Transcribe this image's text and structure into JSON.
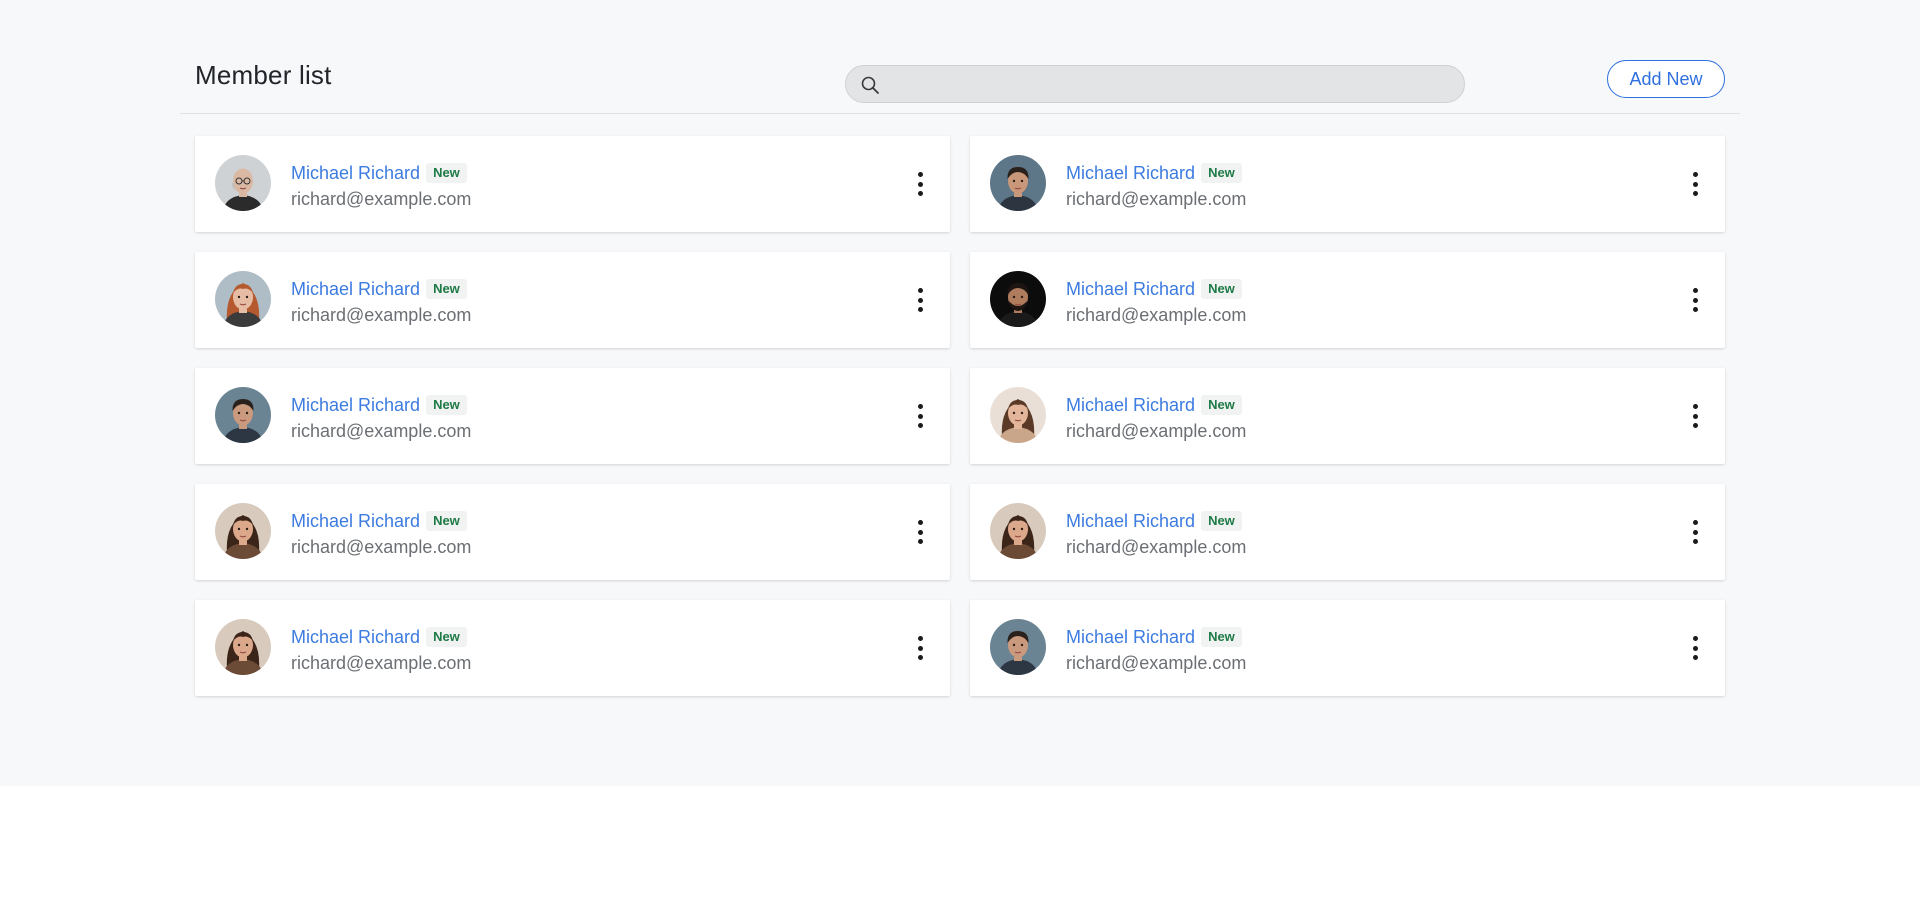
{
  "header": {
    "title": "Member list",
    "search_placeholder": "",
    "search_value": "",
    "add_button_label": "Add New"
  },
  "colors": {
    "accent": "#2f6fdf",
    "name_link": "#3c7be0",
    "badge_text": "#1e7a46",
    "page_bg": "#f7f8fa"
  },
  "members": [
    {
      "name": "Michael Richard",
      "badge": "New",
      "email": "richard@example.com",
      "avatar": "bald-man-glasses",
      "skin": "#d9b9a3",
      "hair": "#bfbfbf",
      "bg": "#cfd2d4",
      "shirt": "#2b2b2b"
    },
    {
      "name": "Michael Richard",
      "badge": "New",
      "email": "richard@example.com",
      "avatar": "young-man-dark-hair",
      "skin": "#c9987b",
      "hair": "#2a211c",
      "bg": "#5d7688",
      "shirt": "#2c3540"
    },
    {
      "name": "Michael Richard",
      "badge": "New",
      "email": "richard@example.com",
      "avatar": "red-hair-woman",
      "skin": "#e6bda4",
      "hair": "#b5592f",
      "bg": "#aebdc6",
      "shirt": "#3b3b3b"
    },
    {
      "name": "Michael Richard",
      "badge": "New",
      "email": "richard@example.com",
      "avatar": "bearded-man",
      "skin": "#b07c5e",
      "hair": "#1d1511",
      "bg": "#0c0c0c",
      "shirt": "#1a1a1a"
    },
    {
      "name": "Michael Richard",
      "badge": "New",
      "email": "richard@example.com",
      "avatar": "man-suit",
      "skin": "#c99a7e",
      "hair": "#2a211c",
      "bg": "#6b8494",
      "shirt": "#2d3744"
    },
    {
      "name": "Michael Richard",
      "badge": "New",
      "email": "richard@example.com",
      "avatar": "long-hair-woman",
      "skin": "#e3b59a",
      "hair": "#5a3a26",
      "bg": "#e9dfd6",
      "shirt": "#c9a58a"
    },
    {
      "name": "Michael Richard",
      "badge": "New",
      "email": "richard@example.com",
      "avatar": "long-hair-woman",
      "skin": "#dba88c",
      "hair": "#3a2518",
      "bg": "#d8cabd",
      "shirt": "#6b4a36"
    },
    {
      "name": "Michael Richard",
      "badge": "New",
      "email": "richard@example.com",
      "avatar": "long-hair-woman",
      "skin": "#dba88c",
      "hair": "#3a2518",
      "bg": "#d8cabd",
      "shirt": "#6b4a36"
    },
    {
      "name": "Michael Richard",
      "badge": "New",
      "email": "richard@example.com",
      "avatar": "long-hair-woman",
      "skin": "#dba88c",
      "hair": "#3a2518",
      "bg": "#d8cabd",
      "shirt": "#6b4a36"
    },
    {
      "name": "Michael Richard",
      "badge": "New",
      "email": "richard@example.com",
      "avatar": "man-suit",
      "skin": "#c99a7e",
      "hair": "#2a211c",
      "bg": "#6b8494",
      "shirt": "#2d3744"
    }
  ]
}
